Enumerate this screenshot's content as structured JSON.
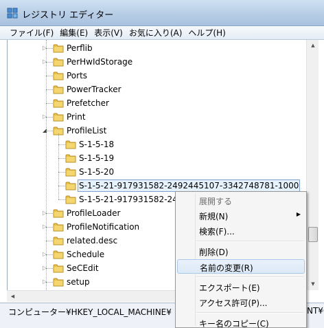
{
  "window": {
    "title": "レジストリ エディター"
  },
  "menu": [
    "ファイル(F)",
    "編集(E)",
    "表示(V)",
    "お気に入り(A)",
    "ヘルプ(H)"
  ],
  "tree": [
    {
      "label": "Perflib",
      "expandable": true
    },
    {
      "label": "PerHwIdStorage",
      "expandable": true
    },
    {
      "label": "Ports",
      "expandable": false
    },
    {
      "label": "PowerTracker",
      "expandable": false
    },
    {
      "label": "Prefetcher",
      "expandable": false
    },
    {
      "label": "Print",
      "expandable": true
    },
    {
      "label": "ProfileList",
      "expandable": true,
      "expanded": true
    },
    {
      "label": "S-1-5-18",
      "child": true
    },
    {
      "label": "S-1-5-19",
      "child": true
    },
    {
      "label": "S-1-5-20",
      "child": true
    },
    {
      "label": "S-1-5-21-917931582-2492445107-3342748781-1000",
      "child": true,
      "selected": true
    },
    {
      "label": "S-1-5-21-917931582-24",
      "child": true
    },
    {
      "label": "ProfileLoader",
      "expandable": true
    },
    {
      "label": "ProfileNotification",
      "expandable": true
    },
    {
      "label": "related.desc",
      "expandable": false
    },
    {
      "label": "Schedule",
      "expandable": true
    },
    {
      "label": "SeCEdit",
      "expandable": true
    },
    {
      "label": "setup",
      "expandable": true
    }
  ],
  "status": {
    "path": "コンピューター¥HKEY_LOCAL_MACHINE¥",
    "path_tail": "NT¥C"
  },
  "context_menu": [
    {
      "label": "展開する",
      "disabled": true
    },
    {
      "label": "新規(N)",
      "submenu": true
    },
    {
      "label": "検索(F)..."
    },
    {
      "separator": true
    },
    {
      "label": "削除(D)"
    },
    {
      "label": "名前の変更(R)",
      "hover": true
    },
    {
      "separator": true
    },
    {
      "label": "エクスポート(E)"
    },
    {
      "label": "アクセス許可(P)..."
    },
    {
      "separator": true
    },
    {
      "label": "キー名のコピー(C)"
    }
  ],
  "colors": {
    "folder": "#e8c04a",
    "selection_bg": "#e5f1fb",
    "selection_border": "#7da2ce",
    "title_bar": "#b7cde6"
  }
}
